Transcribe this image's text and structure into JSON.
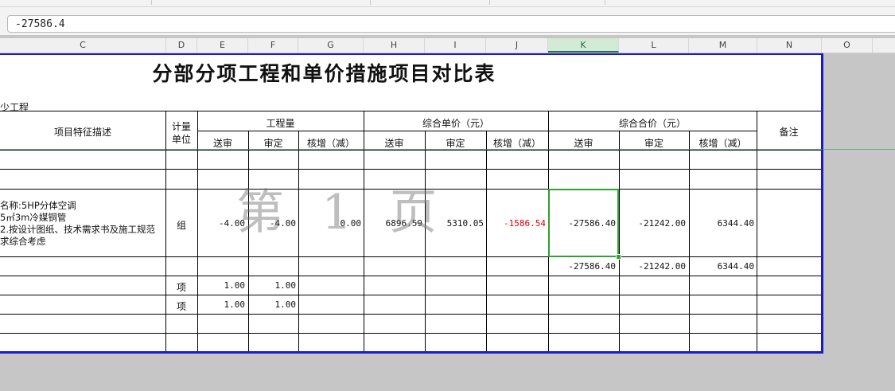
{
  "formula_bar": {
    "value": "-27586.4"
  },
  "columns": [
    "C",
    "D",
    "E",
    "F",
    "G",
    "H",
    "I",
    "J",
    "K",
    "L",
    "M",
    "N",
    "O"
  ],
  "selected_column": "K",
  "sheet": {
    "title": "分部分项工程和单价措施项目对比表",
    "project_name": "少工程",
    "watermark": "第 1 页",
    "headers": {
      "desc": "项目特征描述",
      "unit_line1": "计量",
      "unit_line2": "单位",
      "qty_group": "工程量",
      "price_group": "综合单价（元）",
      "total_group": "综合合价（元）",
      "remark": "备注",
      "submitted": "送审",
      "approved": "审定",
      "diff": "核增（减）"
    },
    "item": {
      "desc_line1": "名称:5HP分体空调",
      "desc_line2": "5㎡3m冷媒铜管",
      "desc_line3": "2.按设计图纸、技术需求书及施工规范",
      "desc_line4": "求综合考虑",
      "unit": "组",
      "qty_submitted": "-4.00",
      "qty_approved": "-4.00",
      "qty_diff": "0.00",
      "price_submitted": "6896.59",
      "price_approved": "5310.05",
      "price_diff": "-1586.54",
      "total_submitted": "-27586.40",
      "total_approved": "-21242.00",
      "total_diff": "6344.40"
    },
    "subtotal": {
      "total_submitted": "-27586.40",
      "total_approved": "-21242.00",
      "total_diff": "6344.40"
    },
    "rows_extra": [
      {
        "unit": "项",
        "qty_submitted": "1.00",
        "qty_approved": "1.00"
      },
      {
        "unit": "项",
        "qty_submitted": "1.00",
        "qty_approved": "1.00"
      }
    ]
  },
  "colors": {
    "selection": "#30a030",
    "negative": "#e00000",
    "print_border": "#1a1acc"
  }
}
